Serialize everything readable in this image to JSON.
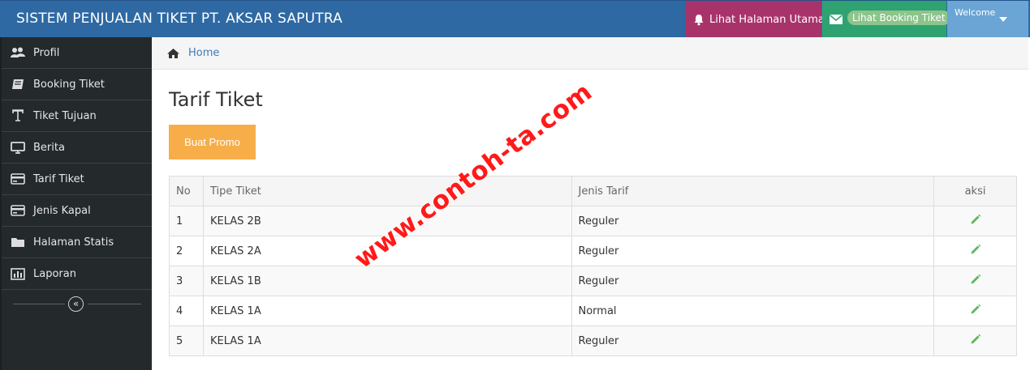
{
  "header": {
    "brand": "SISTEM PENJUALAN TIKET PT. AKSAR SAPUTRA",
    "home_link": "Lihat Halaman Utama",
    "booking_link": "Lihat Booking Tiket",
    "welcome": "Welcome",
    "colors": {
      "bar": "#2e69a3",
      "home": "#a8336b",
      "booking": "#2fa271",
      "welcome": "#6aa5d6"
    }
  },
  "sidebar": {
    "items": [
      {
        "label": "Profil",
        "icon": "users-icon"
      },
      {
        "label": "Booking Tiket",
        "icon": "book-icon"
      },
      {
        "label": "Tiket Tujuan",
        "icon": "text-icon"
      },
      {
        "label": "Berita",
        "icon": "monitor-icon"
      },
      {
        "label": "Tarif Tiket",
        "icon": "card-icon"
      },
      {
        "label": "Jenis Kapal",
        "icon": "card-icon"
      },
      {
        "label": "Halaman Statis",
        "icon": "folder-icon"
      },
      {
        "label": "Laporan",
        "icon": "bar-chart-icon"
      }
    ],
    "collapse_glyph": "«"
  },
  "breadcrumb": {
    "home": "Home"
  },
  "main": {
    "title": "Tarif Tiket",
    "promo_button": "Buat Promo",
    "table": {
      "headers": [
        "No",
        "Tipe Tiket",
        "Jenis Tarif",
        "aksi"
      ],
      "rows": [
        {
          "no": "1",
          "tipe": "KELAS 2B",
          "jenis": "Reguler"
        },
        {
          "no": "2",
          "tipe": "KELAS 2A",
          "jenis": "Reguler"
        },
        {
          "no": "3",
          "tipe": "KELAS 1B",
          "jenis": "Reguler"
        },
        {
          "no": "4",
          "tipe": "KELAS 1A",
          "jenis": "Normal"
        },
        {
          "no": "5",
          "tipe": "KELAS 1A",
          "jenis": "Reguler"
        }
      ]
    }
  },
  "watermark": "www.contoh-ta.com"
}
